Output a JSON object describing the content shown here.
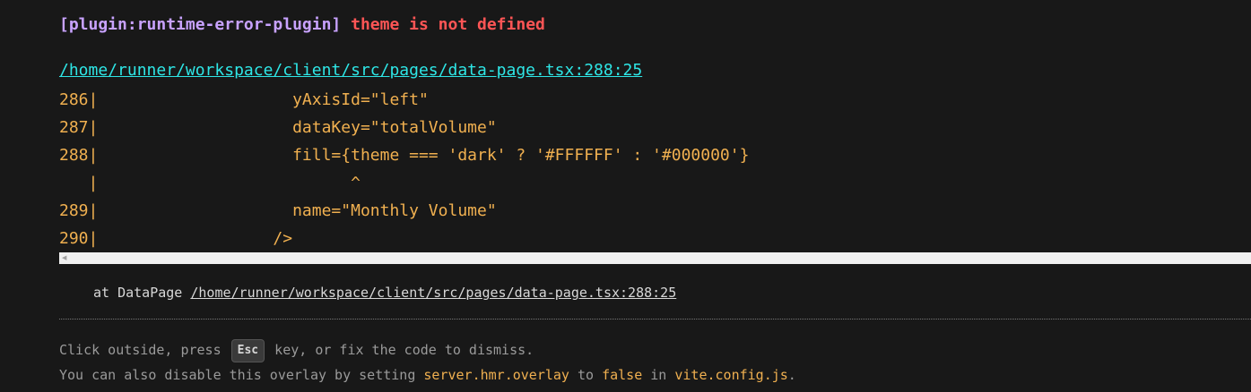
{
  "error": {
    "plugin": "[plugin:runtime-error-plugin]",
    "message": "theme is not defined",
    "file": "/home/runner/workspace/client/src/pages/data-page.tsx:288:25",
    "frame_lines": [
      "286|                    yAxisId=\"left\"",
      "287|                    dataKey=\"totalVolume\"",
      "288|                    fill={theme === 'dark' ? '#FFFFFF' : '#000000'}",
      "   |                          ^",
      "289|                    name=\"Monthly Volume\"",
      "290|                  />"
    ],
    "stack_prefix": "at DataPage ",
    "stack_link": "/home/runner/workspace/client/src/pages/data-page.tsx:288:25"
  },
  "tip": {
    "line1_before": "Click outside, press ",
    "key": "Esc",
    "line1_after": " key, or fix the code to dismiss.",
    "line2_a": "You can also disable this overlay by setting ",
    "line2_code1": "server.hmr.overlay",
    "line2_b": " to ",
    "line2_code2": "false",
    "line2_c": " in ",
    "line2_code3": "vite.config.js",
    "line2_d": "."
  },
  "colors": {
    "background": "#181818",
    "plugin": "#c8a2ff",
    "error": "#ff5555",
    "file_link": "#2ee6e6",
    "frame": "#f0b050",
    "tip": "#9a9a9a"
  }
}
